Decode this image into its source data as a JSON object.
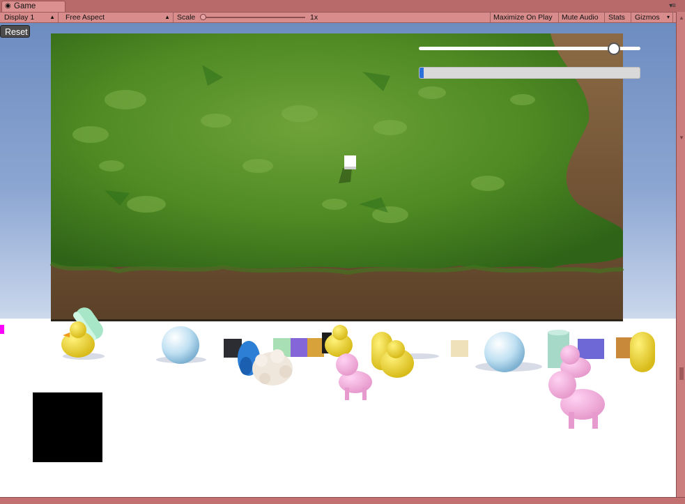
{
  "tab": {
    "title": "Game",
    "icon": "unity-logo-icon",
    "menu_icon": "panel-menu-icon"
  },
  "toolbar": {
    "display": "Display 1",
    "aspect": "Free Aspect",
    "scale_label": "Scale",
    "scale_value": "1x",
    "scale_level": 0,
    "maximize": "Maximize On Play",
    "mute": "Mute Audio",
    "stats": "Stats",
    "gizmos": "Gizmos"
  },
  "game": {
    "reset_label": "Reset",
    "slider_value": 0.88,
    "progress_value": 0.02,
    "colors": {
      "slider_knob": "#ffffff",
      "progress_fill": "#2d6fd8",
      "marker": "#ff00ff",
      "ground": "#ffffff",
      "sky": "#6d8cc0",
      "grass": "#4f8a23",
      "dirt": "#7a5a3a"
    }
  },
  "scene_objects": [
    "duck",
    "capsule",
    "sphere",
    "cube",
    "penguin",
    "sheep",
    "pig",
    "cylinder"
  ]
}
